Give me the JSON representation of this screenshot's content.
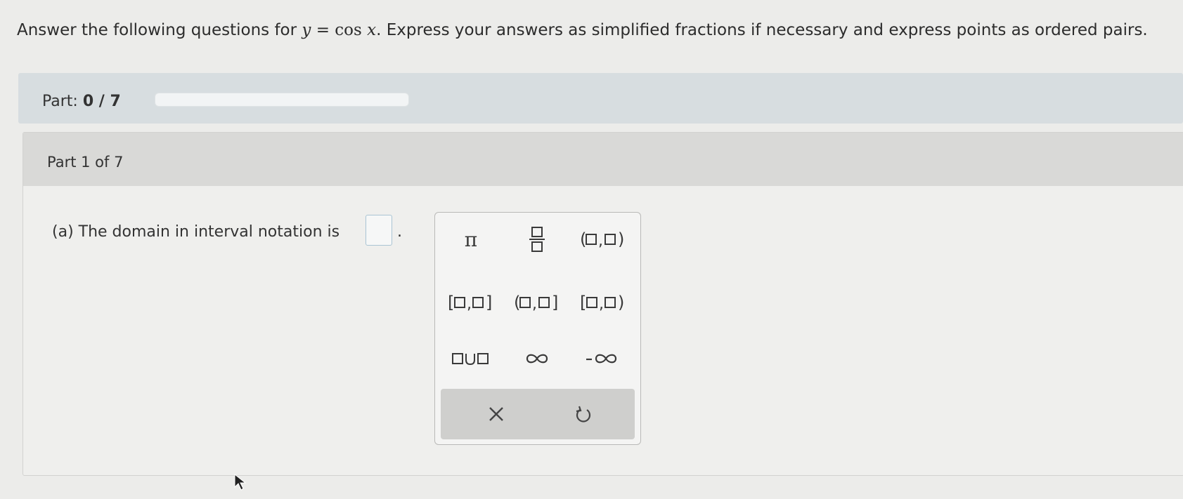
{
  "question": {
    "prefix": "Answer the following questions for ",
    "equation_y": "y",
    "equation_eq": " = cos ",
    "equation_x": "x",
    "suffix": ". Express your answers as simplified fractions if necessary and express points as ordered pairs."
  },
  "progress": {
    "label": "Part:",
    "current": "0 / 7",
    "fraction_complete": 0
  },
  "part": {
    "title": "Part 1 of 7",
    "prompt": "(a) The domain in interval notation is",
    "period": "."
  },
  "keypad": {
    "keys": [
      {
        "name": "pi-key",
        "icon": "pi"
      },
      {
        "name": "fraction-key",
        "icon": "fraction"
      },
      {
        "name": "open-open-interval-key",
        "icon": "interval-open-open"
      },
      {
        "name": "closed-closed-interval-key",
        "icon": "interval-closed-closed"
      },
      {
        "name": "open-closed-interval-key",
        "icon": "interval-open-closed"
      },
      {
        "name": "closed-open-interval-key",
        "icon": "interval-closed-open"
      },
      {
        "name": "union-key",
        "icon": "union"
      },
      {
        "name": "infinity-key",
        "icon": "infinity"
      },
      {
        "name": "negative-infinity-key",
        "icon": "negative-infinity"
      }
    ],
    "footer": [
      {
        "name": "clear-button",
        "icon": "x-icon"
      },
      {
        "name": "undo-button",
        "icon": "undo-icon"
      }
    ]
  },
  "colors": {
    "progress_fill": "#4a8fbf",
    "answer_box_border": "#a9c4d4"
  }
}
